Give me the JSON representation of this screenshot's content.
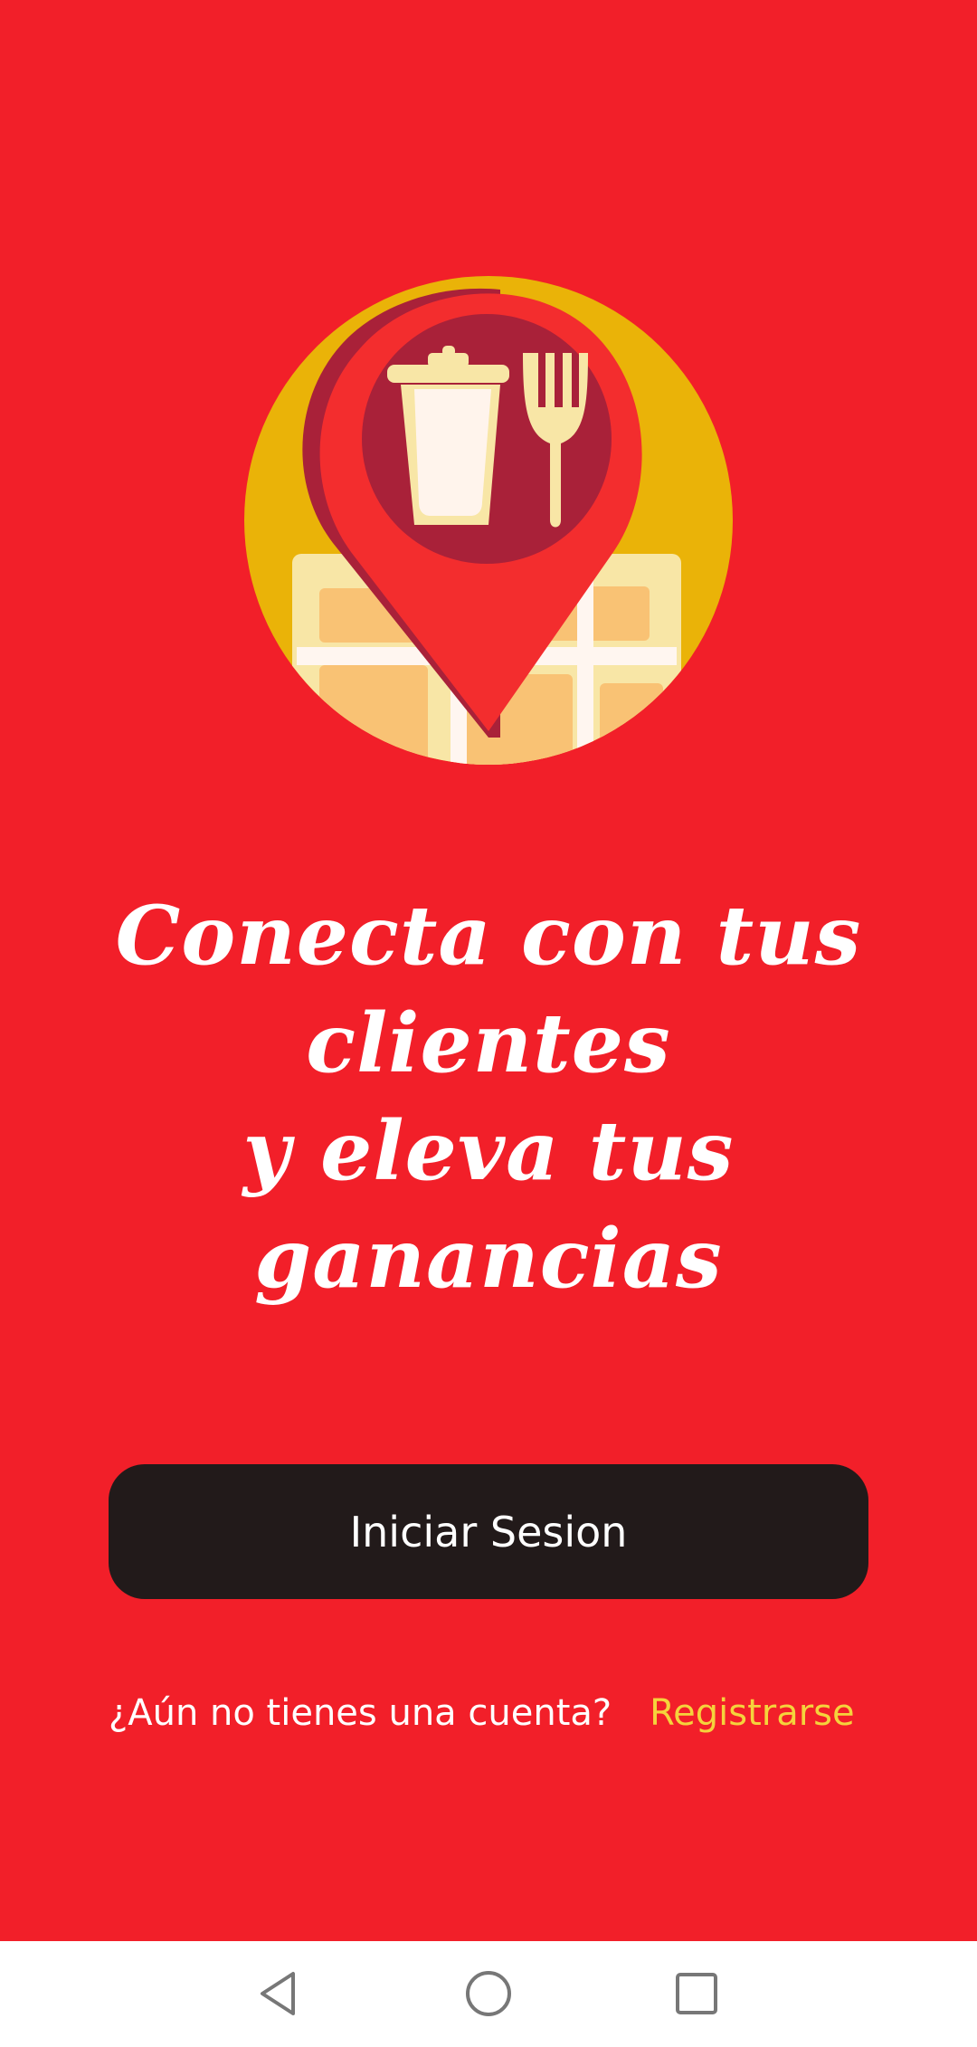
{
  "colors": {
    "background": "#F21F29",
    "button_background": "#221A1A",
    "link": "#F5D33C",
    "text": "#FFFFFF",
    "nav_bar": "#FFFFFF"
  },
  "hero": {
    "icon": "restaurant-location-pin-illustration"
  },
  "headline": {
    "lines": [
      "Conecta con tus",
      "clientes",
      "y eleva tus",
      "ganancias"
    ]
  },
  "login_button": {
    "label": "Iniciar Sesion"
  },
  "register": {
    "prompt": "¿Aún no tienes una cuenta?",
    "link": "Registrarse"
  },
  "nav": {
    "back_icon": "back-triangle-icon",
    "home_icon": "home-circle-icon",
    "recents_icon": "recents-square-icon"
  }
}
